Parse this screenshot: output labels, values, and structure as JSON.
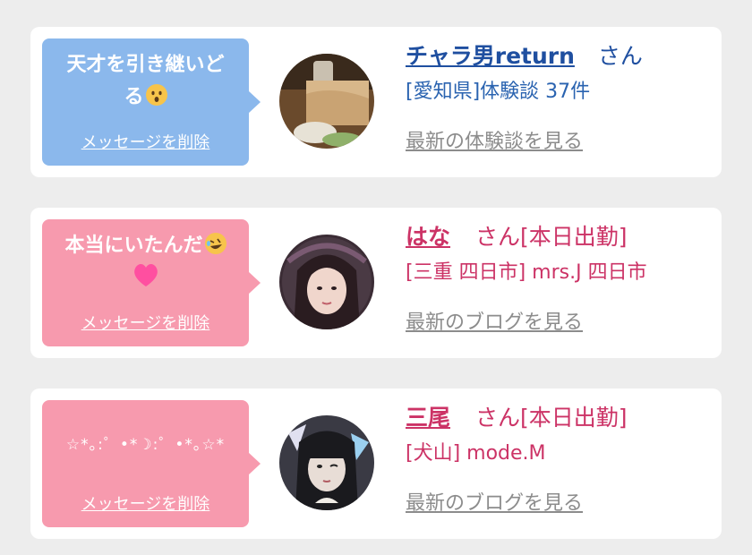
{
  "entries": [
    {
      "bubble_text_1": "天才を引き継いど",
      "bubble_text_2": "る",
      "bubble_emoji": "astonished-face-icon",
      "delete_label": "メッセージを削除",
      "name": "チャラ男return",
      "honorific": "さん",
      "status": "",
      "detail": "[愛知県]体験談 37件",
      "link": "最新の体験談を見る",
      "bubble_color": "#8bb8ec"
    },
    {
      "bubble_text_1": "本当にいたんだ",
      "bubble_emoji": "rolling-laughing-face-icon",
      "bubble_emoji_2": "pink-heart-icon",
      "delete_label": "メッセージを削除",
      "name": "はな",
      "honorific": "さん",
      "status": "[本日出勤]",
      "detail": "[三重 四日市] mrs.J 四日市",
      "link": "最新のブログを見る",
      "bubble_color": "#f79aae"
    },
    {
      "bubble_text_1": "☆*｡:゜•*☽:゜•*｡☆*",
      "delete_label": "メッセージを削除",
      "name": "三尾",
      "honorific": "さん",
      "status": "[本日出勤]",
      "detail": "[犬山] mode.M",
      "link": "最新のブログを見る",
      "bubble_color": "#f79aae"
    }
  ]
}
